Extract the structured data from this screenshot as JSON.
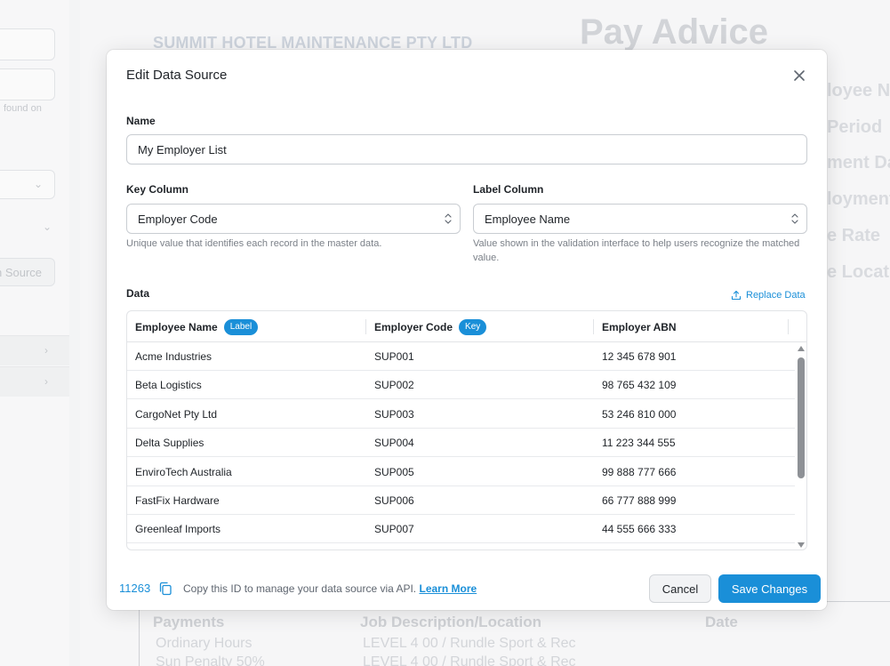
{
  "background": {
    "left_hint": "found on",
    "left_source_button": "n Source",
    "company": "SUMMIT HOTEL MAINTENANCE PTY LTD",
    "doc_title": "Pay Advice",
    "fields": [
      "loyee N",
      "Period",
      "ment Da",
      "loyment",
      "e Rate",
      "e Locat"
    ],
    "table_headers": [
      "Payments",
      "Job Description/Location",
      "Date"
    ],
    "table_rows": [
      {
        "payment": "Ordinary Hours",
        "job": "LEVEL 4 00 / Rundle Sport & Rec"
      },
      {
        "payment": "Sun Penalty 50%",
        "job": "LEVEL 4 00 / Rundle Sport & Rec"
      }
    ]
  },
  "modal": {
    "title": "Edit Data Source",
    "name_label": "Name",
    "name_value": "My Employer List",
    "key_column_label": "Key Column",
    "key_column_value": "Employer Code",
    "key_column_help": "Unique value that identifies each record in the master data.",
    "label_column_label": "Label Column",
    "label_column_value": "Employee Name",
    "label_column_help": "Value shown in the validation interface to help users recognize the matched value.",
    "data_label": "Data",
    "replace_data_label": "Replace Data",
    "table": {
      "columns": [
        {
          "name": "Employee Name",
          "badge": "Label"
        },
        {
          "name": "Employer Code",
          "badge": "Key"
        },
        {
          "name": "Employer ABN",
          "badge": ""
        }
      ],
      "rows": [
        [
          "Acme Industries",
          "SUP001",
          "12 345 678 901"
        ],
        [
          "Beta Logistics",
          "SUP002",
          "98 765 432 109"
        ],
        [
          "CargoNet Pty Ltd",
          "SUP003",
          "53 246 810 000"
        ],
        [
          "Delta Supplies",
          "SUP004",
          "11 223 344 555"
        ],
        [
          "EnviroTech Australia",
          "SUP005",
          "99 888 777 666"
        ],
        [
          "FastFix Hardware",
          "SUP006",
          "66 777 888 999"
        ],
        [
          "Greenleaf Imports",
          "SUP007",
          "44 555 666 333"
        ]
      ]
    },
    "footer": {
      "id": "11263",
      "note": "Copy this ID to manage your data source via API.",
      "learn_more": "Learn More",
      "cancel_label": "Cancel",
      "save_label": "Save Changes"
    }
  },
  "colors": {
    "accent": "#1a8fd8",
    "text": "#1f2328",
    "muted": "#7b8088",
    "border": "#c9cdd2"
  },
  "icons": {
    "close": "close-icon",
    "select_arrows": "chevron-updown-icon",
    "replace": "upload-icon",
    "copy": "copy-icon"
  }
}
